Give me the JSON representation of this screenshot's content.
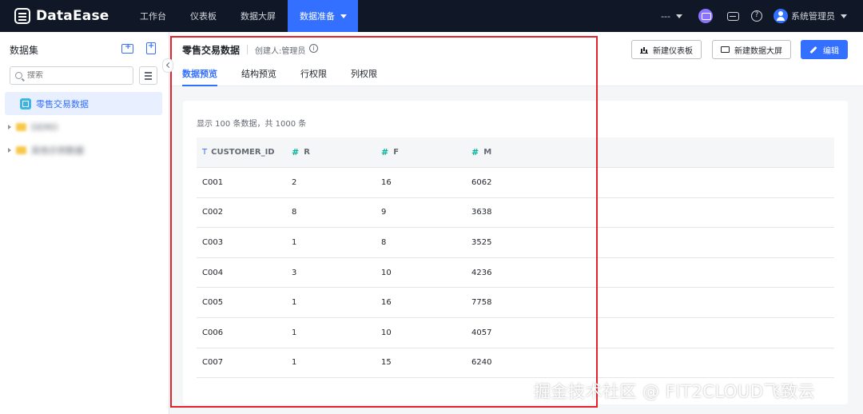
{
  "app": {
    "name": "DataEase"
  },
  "nav": {
    "items": [
      {
        "label": "工作台"
      },
      {
        "label": "仪表板"
      },
      {
        "label": "数据大屏"
      },
      {
        "label": "数据准备"
      }
    ],
    "active_index": 3
  },
  "topbar": {
    "workspace": "---",
    "user": "系统管理员"
  },
  "sidebar": {
    "title": "数据集",
    "search_placeholder": "搜索",
    "selected_item": "零售交易数据",
    "folders": [
      {
        "label": "DEMO"
      },
      {
        "label": "其他示例数据"
      }
    ]
  },
  "header": {
    "title": "零售交易数据",
    "creator": "创建人:管理员",
    "tabs": [
      "数据预览",
      "结构预览",
      "行权限",
      "列权限"
    ],
    "active_tab": 0,
    "buttons": {
      "new_dashboard": "新建仪表板",
      "new_screen": "新建数据大屏",
      "edit": "编辑"
    }
  },
  "preview": {
    "summary": "显示 100 条数据，共 1000 条",
    "columns": [
      {
        "type": "T",
        "name": "CUSTOMER_ID"
      },
      {
        "type": "#",
        "name": "R"
      },
      {
        "type": "#",
        "name": "F"
      },
      {
        "type": "#",
        "name": "M"
      }
    ],
    "rows": [
      [
        "C001",
        "2",
        "16",
        "6062"
      ],
      [
        "C002",
        "8",
        "9",
        "3638"
      ],
      [
        "C003",
        "1",
        "8",
        "3525"
      ],
      [
        "C004",
        "3",
        "10",
        "4236"
      ],
      [
        "C005",
        "1",
        "16",
        "7758"
      ],
      [
        "C006",
        "1",
        "10",
        "4057"
      ],
      [
        "C007",
        "1",
        "15",
        "6240"
      ]
    ]
  },
  "watermark": "掘金技术社区 @ FIT2CLOUD飞致云",
  "colors": {
    "topbar": "#101827",
    "accent": "#3370ff",
    "number_type": "#04b49c",
    "highlight": "#e5222c"
  }
}
